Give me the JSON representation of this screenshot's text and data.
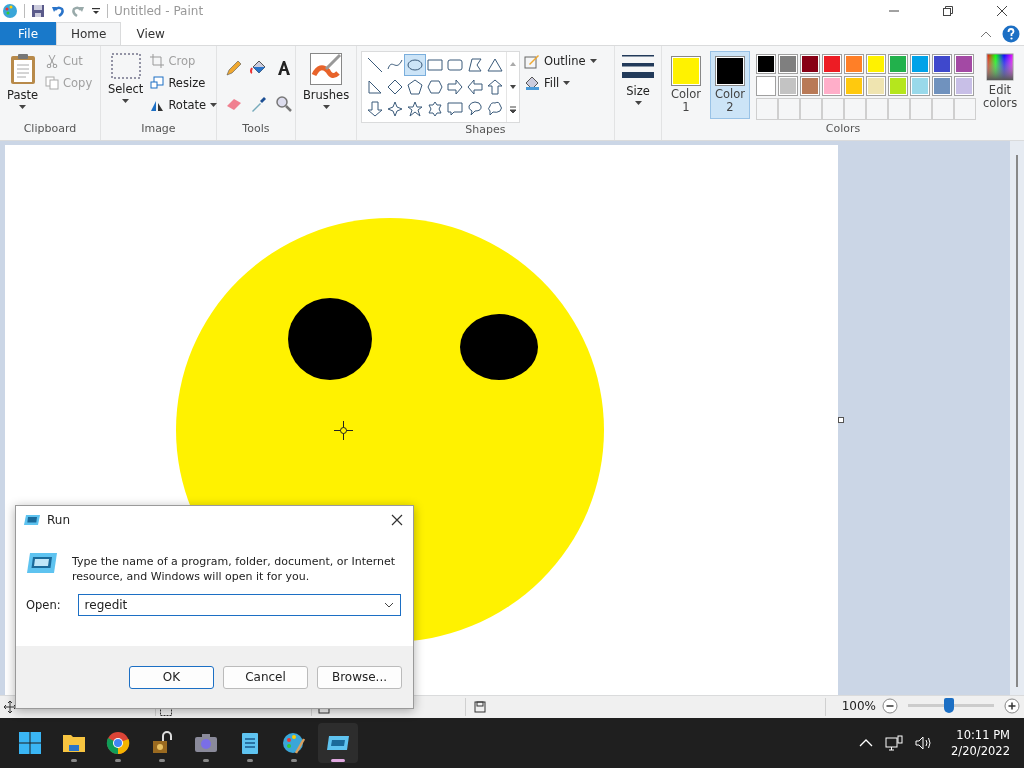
{
  "window": {
    "title": "Untitled - Paint"
  },
  "tabs": [
    {
      "label": "File",
      "kind": "file",
      "selected": false
    },
    {
      "label": "Home",
      "kind": "tab",
      "selected": true
    },
    {
      "label": "View",
      "kind": "tab",
      "selected": false
    }
  ],
  "clipboard": {
    "label": "Clipboard",
    "paste": "Paste",
    "cut": {
      "label": "Cut",
      "disabled": true
    },
    "copy": {
      "label": "Copy",
      "disabled": true
    }
  },
  "image": {
    "label": "Image",
    "select": "Select",
    "crop": {
      "label": "Crop",
      "disabled": true
    },
    "resize": {
      "label": "Resize",
      "disabled": false
    },
    "rotate": {
      "label": "Rotate",
      "disabled": false
    }
  },
  "tools": {
    "label": "Tools"
  },
  "brushes": {
    "label": "Brushes"
  },
  "shapes": {
    "label": "Shapes",
    "outline": "Outline",
    "fill": "Fill",
    "items": [
      {
        "kind": "line",
        "selected": false
      },
      {
        "kind": "curve",
        "selected": false
      },
      {
        "kind": "oval",
        "selected": true
      },
      {
        "kind": "rect",
        "selected": false
      },
      {
        "kind": "roundrect",
        "selected": false
      },
      {
        "kind": "polygon",
        "selected": false
      },
      {
        "kind": "triangle",
        "selected": false
      },
      {
        "kind": "right-triangle",
        "selected": false
      },
      {
        "kind": "diamond",
        "selected": false
      },
      {
        "kind": "pentagon",
        "selected": false
      },
      {
        "kind": "hexagon",
        "selected": false
      },
      {
        "kind": "arrow-right",
        "selected": false
      },
      {
        "kind": "arrow-left",
        "selected": false
      },
      {
        "kind": "arrow-up",
        "selected": false
      },
      {
        "kind": "arrow-down",
        "selected": false
      },
      {
        "kind": "star4",
        "selected": false
      },
      {
        "kind": "star5",
        "selected": false
      },
      {
        "kind": "star6",
        "selected": false
      },
      {
        "kind": "callout-rect",
        "selected": false
      },
      {
        "kind": "callout-oval",
        "selected": false
      },
      {
        "kind": "callout-cloud",
        "selected": false
      }
    ]
  },
  "size": {
    "label": "Size"
  },
  "colors": {
    "label": "Colors",
    "color1": {
      "label": "Color 1",
      "color": "#fff200",
      "selected": false
    },
    "color2": {
      "label": "Color 2",
      "color": "#000000",
      "selected": true
    },
    "edit": "Edit colors",
    "palette": [
      {
        "color": "#000000"
      },
      {
        "color": "#7f7f7f"
      },
      {
        "color": "#880015"
      },
      {
        "color": "#ed1c24"
      },
      {
        "color": "#ff7f27"
      },
      {
        "color": "#fff200"
      },
      {
        "color": "#22b14c"
      },
      {
        "color": "#00a2e8"
      },
      {
        "color": "#3f48cc"
      },
      {
        "color": "#a349a4"
      },
      {
        "color": "#ffffff"
      },
      {
        "color": "#c3c3c3"
      },
      {
        "color": "#b97a57"
      },
      {
        "color": "#ffaec9"
      },
      {
        "color": "#ffc90e"
      },
      {
        "color": "#efe4b0"
      },
      {
        "color": "#b5e61d"
      },
      {
        "color": "#99d9ea"
      },
      {
        "color": "#7092be"
      },
      {
        "color": "#c8bfe7"
      }
    ]
  },
  "status_bar": {
    "zoom": "100%",
    "zoom_slider": {
      "level": 0.48
    }
  },
  "run_dialog": {
    "title": "Run",
    "message": "Type the name of a program, folder, document, or Internet resource, and Windows will open it for you.",
    "open_label": "Open:",
    "value": "regedit",
    "buttons": [
      {
        "label": "OK",
        "default": true
      },
      {
        "label": "Cancel",
        "default": false
      },
      {
        "label": "Browse...",
        "default": false
      }
    ]
  },
  "taskbar": {
    "apps": [
      {
        "kind": "start",
        "running": false,
        "selected": false
      },
      {
        "kind": "folder",
        "running": true,
        "selected": false
      },
      {
        "kind": "browser",
        "running": true,
        "selected": false
      },
      {
        "kind": "lock",
        "running": true,
        "selected": false
      },
      {
        "kind": "camera",
        "running": true,
        "selected": false
      },
      {
        "kind": "notepad",
        "running": true,
        "selected": false
      },
      {
        "kind": "paint",
        "running": true,
        "selected": false
      },
      {
        "kind": "run",
        "running": true,
        "selected": true
      }
    ],
    "time": "10:11 PM",
    "date": "2/20/2022"
  }
}
